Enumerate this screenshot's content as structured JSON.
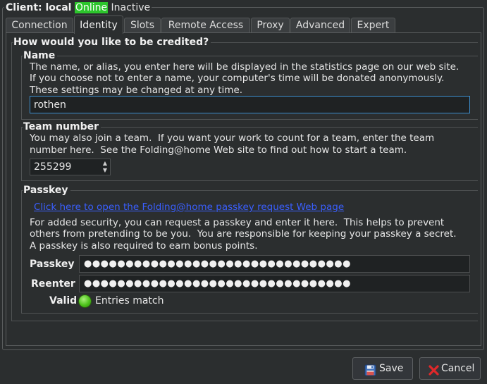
{
  "client": {
    "label": "Client: local",
    "status": "Online",
    "state": "Inactive"
  },
  "tabs": [
    {
      "label": "Connection"
    },
    {
      "label": "Identity"
    },
    {
      "label": "Slots"
    },
    {
      "label": "Remote Access"
    },
    {
      "label": "Proxy"
    },
    {
      "label": "Advanced"
    },
    {
      "label": "Expert"
    }
  ],
  "active_tab": "Identity",
  "identity": {
    "heading": "How would you like to be credited?",
    "name_group": {
      "title": "Name",
      "description": [
        "The name, or alias, you enter here will be displayed in the statistics page on our web site.",
        "If you choose not to enter a name, your computer's time will be donated anonymously.",
        "These settings may be changed at any time."
      ],
      "value": "rothen"
    },
    "team_group": {
      "title": "Team number",
      "description": [
        "You may also join a team.  If you want your work to count for a team, enter the team",
        "number here.  See the Folding@home Web site to find out how to start a team."
      ],
      "value": "255299"
    },
    "passkey_group": {
      "title": "Passkey",
      "link": "Click here to open the Folding@home passkey request Web page",
      "description": [
        "For added security, you can request a passkey and enter it here.  This helps to prevent",
        "others from pretending to be you.  You are responsible for keeping your passkey a secret.",
        "A passkey is also required to earn bonus points."
      ],
      "passkey_label": "Passkey",
      "passkey_mask": "●●●●●●●●●●●●●●●●●●●●●●●●●●●●●●●●",
      "reenter_label": "Reenter",
      "reenter_mask": "●●●●●●●●●●●●●●●●●●●●●●●●●●●●●●●●",
      "valid_label": "Valid",
      "valid_status": "Entries match",
      "valid_color": "#4cc21a"
    }
  },
  "buttons": {
    "save": "Save",
    "cancel": "Cancel"
  },
  "colors": {
    "background": "#2b2e2f",
    "online_badge": "#2cc52c",
    "link": "#3a5fff",
    "focus_border": "#3d8fcf",
    "cancel_icon": "#e0282a"
  },
  "icons": {
    "save": "floppy-disk-icon",
    "cancel": "red-x-icon"
  }
}
